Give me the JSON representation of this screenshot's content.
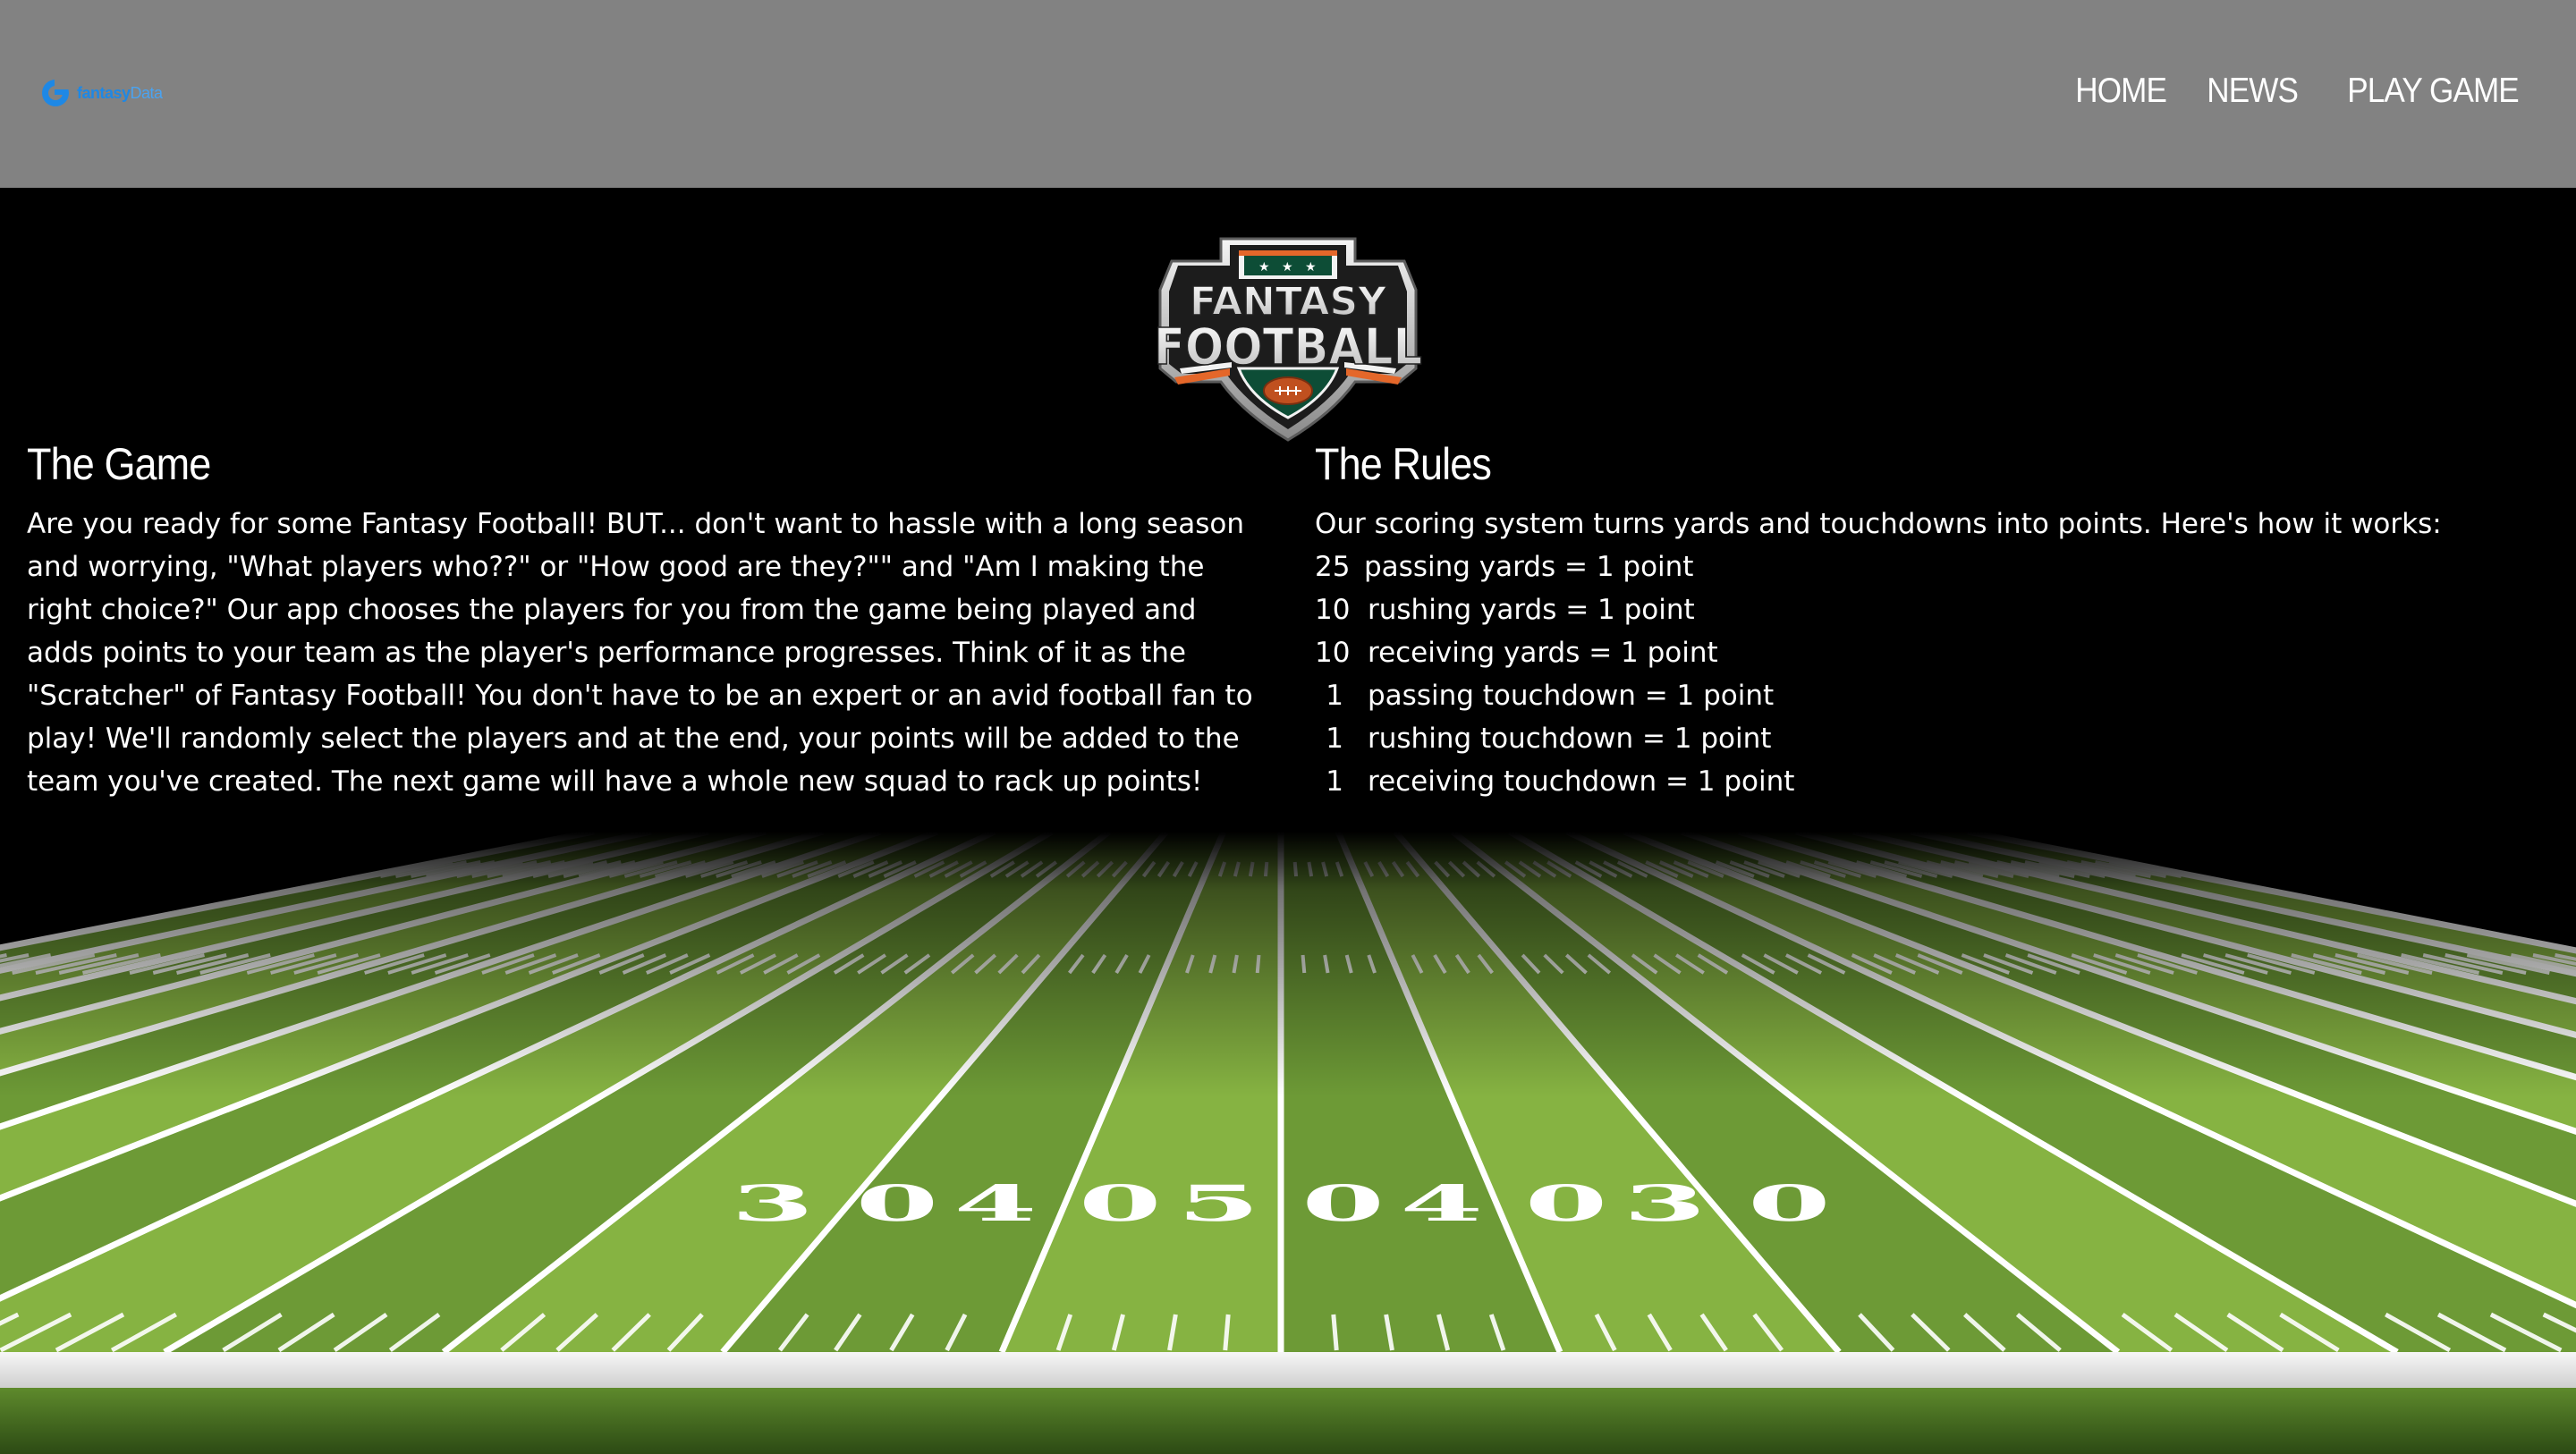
{
  "navbar": {
    "brand": {
      "icon": "fantasy-logo-icon",
      "name_bold": "fantasy",
      "name_light": "Data"
    },
    "links": [
      "HOME",
      "NEWS",
      "PLAY GAME"
    ]
  },
  "hero": {
    "logo": {
      "line1": "FANTASY",
      "line2": "FOOTBALL"
    },
    "game": {
      "heading": "The Game",
      "body": "Are you ready for some Fantasy Football! BUT... don't want to hassle with a long season and worrying, \"What players who??\" or \"How good are they?\"\" and \"Am I making the right choice?\" Our app chooses the players for you from the game being played and adds points to your team as the player's performance progresses. Think of it as the \"Scratcher\" of Fantasy Football! You don't have to be an expert or an avid football fan to play! We'll randomly select the players and at the end, your points will be added to the team you've created. The next game will have a whole new squad to rack up points!"
    },
    "rules": {
      "heading": "The Rules",
      "intro": "Our scoring system turns yards and touchdowns into points. Here's how it works:",
      "items": [
        {
          "num": "25",
          "text": "passing yards = 1 point"
        },
        {
          "num": "10",
          "text": "rushing yards = 1 point"
        },
        {
          "num": "10",
          "text": "receiving yards = 1 point"
        },
        {
          "num": "1",
          "text": "passing touchdown = 1 point"
        },
        {
          "num": "1",
          "text": "rushing touchdown = 1 point"
        },
        {
          "num": "1",
          "text": "receiving touchdown = 1 point"
        }
      ]
    }
  },
  "field": {
    "yard_numbers": [
      "30",
      "40",
      "50",
      "40",
      "30"
    ],
    "colors": {
      "grass_light": "#86b342",
      "grass_dark": "#6d9a36",
      "line": "#ffffff"
    }
  }
}
